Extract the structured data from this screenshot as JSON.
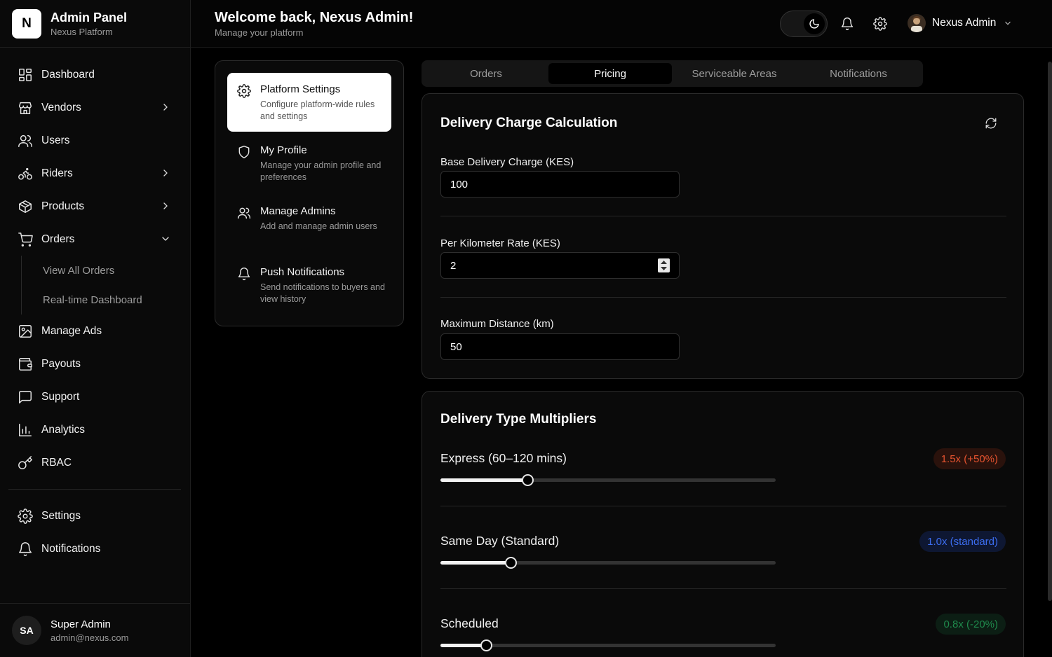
{
  "brand": {
    "logo_letter": "N",
    "title": "Admin Panel",
    "subtitle": "Nexus Platform"
  },
  "sidebar": {
    "items": [
      {
        "label": "Dashboard",
        "icon": "dashboard-icon"
      },
      {
        "label": "Vendors",
        "icon": "store-icon",
        "expandable": true
      },
      {
        "label": "Users",
        "icon": "users-icon"
      },
      {
        "label": "Riders",
        "icon": "bike-icon",
        "expandable": true
      },
      {
        "label": "Products",
        "icon": "package-icon",
        "expandable": true
      },
      {
        "label": "Orders",
        "icon": "cart-icon",
        "expanded": true
      },
      {
        "label": "Manage Ads",
        "icon": "image-icon"
      },
      {
        "label": "Payouts",
        "icon": "wallet-icon"
      },
      {
        "label": "Support",
        "icon": "message-icon"
      },
      {
        "label": "Analytics",
        "icon": "chart-icon"
      },
      {
        "label": "RBAC",
        "icon": "key-icon"
      }
    ],
    "orders_sub": [
      "View All Orders",
      "Real-time Dashboard"
    ],
    "bottom_items": [
      {
        "label": "Settings",
        "icon": "gear-icon"
      },
      {
        "label": "Notifications",
        "icon": "bell-icon"
      }
    ]
  },
  "footer_user": {
    "initials": "SA",
    "name": "Super Admin",
    "email": "admin@nexus.com"
  },
  "header": {
    "welcome": "Welcome back, Nexus Admin!",
    "subtitle": "Manage your platform",
    "user_name": "Nexus Admin"
  },
  "settings_menu": [
    {
      "title": "Platform Settings",
      "desc": "Configure platform-wide rules and settings",
      "icon": "gear-icon",
      "active": true
    },
    {
      "title": "My Profile",
      "desc": "Manage your admin profile and preferences",
      "icon": "shield-icon"
    },
    {
      "title": "Manage Admins",
      "desc": "Add and manage admin users",
      "icon": "users-icon"
    },
    {
      "title": "Push Notifications",
      "desc": "Send notifications to buyers and view history",
      "icon": "bell-icon"
    }
  ],
  "tabs": [
    {
      "label": "Orders"
    },
    {
      "label": "Pricing",
      "active": true
    },
    {
      "label": "Serviceable Areas"
    },
    {
      "label": "Notifications"
    }
  ],
  "delivery_charge": {
    "title": "Delivery Charge Calculation",
    "base_label": "Base Delivery Charge (KES)",
    "base_value": "100",
    "per_km_label": "Per Kilometer Rate (KES)",
    "per_km_value": "2",
    "max_distance_label": "Maximum Distance (km)",
    "max_distance_value": "50"
  },
  "multipliers": {
    "title": "Delivery Type Multipliers",
    "items": [
      {
        "label": "Express (60–120 mins)",
        "badge": "1.5x (+50%)",
        "badge_color": "#e5532f",
        "badge_bg": "#2a120c",
        "slider_fraction": 0.26
      },
      {
        "label": "Same Day (Standard)",
        "badge": "1.0x (standard)",
        "badge_color": "#3c6df0",
        "badge_bg": "#0e1732",
        "slider_fraction": 0.21
      },
      {
        "label": "Scheduled",
        "badge": "0.8x (-20%)",
        "badge_color": "#1f8a4c",
        "badge_bg": "#0c1e14",
        "slider_fraction": 0.135
      }
    ]
  }
}
